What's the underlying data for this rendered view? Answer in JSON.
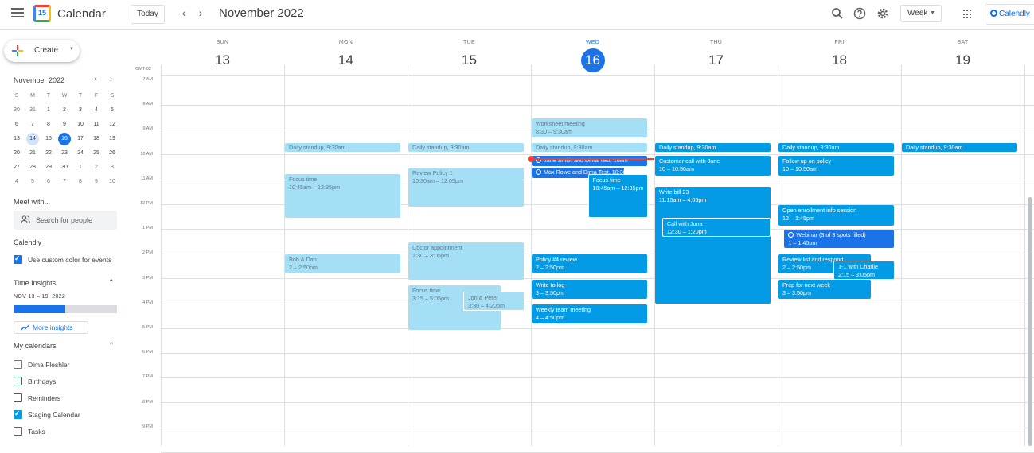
{
  "header": {
    "app_title": "Calendar",
    "logo_text": "15",
    "today_label": "Today",
    "prev_icon": "chevron-left-icon",
    "next_icon": "chevron-right-icon",
    "current_month": "November 2022",
    "view_label": "Week",
    "calendly_label": "Calendly",
    "icons": [
      "search-icon",
      "help-icon",
      "settings-icon",
      "apps-grid-icon"
    ]
  },
  "sidebar": {
    "create_label": "Create",
    "mini_calendar": {
      "title": "November 2022",
      "weekdays": [
        "S",
        "M",
        "T",
        "W",
        "T",
        "F",
        "S"
      ],
      "weeks": [
        [
          "30",
          "31",
          "1",
          "2",
          "3",
          "4",
          "5"
        ],
        [
          "6",
          "7",
          "8",
          "9",
          "10",
          "11",
          "12"
        ],
        [
          "13",
          "14",
          "15",
          "16",
          "17",
          "18",
          "19"
        ],
        [
          "20",
          "21",
          "22",
          "23",
          "24",
          "25",
          "26"
        ],
        [
          "27",
          "28",
          "29",
          "30",
          "1",
          "2",
          "3"
        ],
        [
          "4",
          "5",
          "6",
          "7",
          "8",
          "9",
          "10"
        ]
      ]
    },
    "meet_with": {
      "title": "Meet with...",
      "search_placeholder": "Search for people"
    },
    "calendly": {
      "title": "Calendly",
      "checkbox_label": "Use custom color for events"
    },
    "time_insights": {
      "title": "Time Insights",
      "range": "NOV 13 – 19, 2022",
      "fill_fraction": 0.5,
      "more_label": "More insights"
    },
    "my_calendars": {
      "title": "My calendars",
      "items": [
        {
          "label": "Dima Fleshler",
          "color": "#039be5",
          "checked": false
        },
        {
          "label": "Birthdays",
          "color": "#0b8043",
          "checked": false
        },
        {
          "label": "Reminders",
          "color": "#3f51b5",
          "checked": false
        },
        {
          "label": "Staging Calendar",
          "color": "#039be5",
          "checked": true
        },
        {
          "label": "Tasks",
          "color": "#1a73e8",
          "checked": false
        }
      ]
    }
  },
  "week": {
    "timezone": "GMT-02",
    "days": [
      {
        "dow": "SUN",
        "num": "13"
      },
      {
        "dow": "MON",
        "num": "14"
      },
      {
        "dow": "TUE",
        "num": "15"
      },
      {
        "dow": "WED",
        "num": "16",
        "today": true
      },
      {
        "dow": "THU",
        "num": "17"
      },
      {
        "dow": "FRI",
        "num": "18"
      },
      {
        "dow": "SAT",
        "num": "19"
      }
    ],
    "hours": [
      "7 AM",
      "8 AM",
      "9 AM",
      "10 AM",
      "11 AM",
      "12 PM",
      "1 PM",
      "2 PM",
      "3 PM",
      "4 PM",
      "5 PM",
      "6 PM",
      "7 PM",
      "8 PM",
      "9 PM"
    ],
    "now_hour": 10.15,
    "events": [
      {
        "day": 1,
        "start": 9.5,
        "end": 9.9,
        "title": "Daily standup, 9:30am",
        "style": "light chip"
      },
      {
        "day": 2,
        "start": 9.5,
        "end": 9.9,
        "title": "Daily standup, 9:30am",
        "style": "light chip"
      },
      {
        "day": 3,
        "start": 9.5,
        "end": 9.9,
        "title": "Daily standup, 9:30am",
        "style": "light chip"
      },
      {
        "day": 4,
        "start": 9.5,
        "end": 9.9,
        "title": "Daily standup, 9:30am",
        "style": "dark chip"
      },
      {
        "day": 5,
        "start": 9.5,
        "end": 9.9,
        "title": "Daily standup, 9:30am",
        "style": "dark chip"
      },
      {
        "day": 6,
        "start": 9.5,
        "end": 9.9,
        "title": "Daily standup, 9:30am",
        "style": "dark chip"
      },
      {
        "day": 3,
        "start": 8.5,
        "end": 9.3,
        "title": "Worksheet meeting",
        "time": "8:30 – 9:30am",
        "style": "light"
      },
      {
        "day": 3,
        "start": 10.0,
        "end": 10.45,
        "title": "Jane Smith and Dima Test, 10am",
        "style": "highlight chip",
        "recurring": true
      },
      {
        "day": 3,
        "start": 10.5,
        "end": 10.95,
        "title": "Max Rowe and Dima Test, 10:30am",
        "style": "highlight chip",
        "recurring": true,
        "width": 0.8
      },
      {
        "day": 3,
        "start": 10.75,
        "end": 12.55,
        "title": "Focus time",
        "time": "10:45am – 12:35pm",
        "style": "dark outlined",
        "offset": 0.48
      },
      {
        "day": 1,
        "start": 10.75,
        "end": 12.55,
        "title": "Focus time",
        "time": "10:45am – 12:35pm",
        "style": "light"
      },
      {
        "day": 2,
        "start": 10.5,
        "end": 12.1,
        "title": "Review Policy 1",
        "time": "10:30am – 12:05pm",
        "style": "light"
      },
      {
        "day": 4,
        "start": 10.0,
        "end": 10.85,
        "title": "Customer call with Jane",
        "time": "10 – 10:50am",
        "style": "dark"
      },
      {
        "day": 5,
        "start": 10.0,
        "end": 10.85,
        "title": "Follow up on policy",
        "time": "10 – 10:50am",
        "style": "dark"
      },
      {
        "day": 4,
        "start": 11.25,
        "end": 16.0,
        "title": "Write bill 23",
        "time": "11:15am – 4:05pm",
        "style": "dark"
      },
      {
        "day": 4,
        "start": 12.5,
        "end": 13.3,
        "title": "Call with Jona",
        "time": "12:30 – 1:20pm",
        "style": "dark outlined",
        "offset": 0.06
      },
      {
        "day": 5,
        "start": 12.0,
        "end": 12.85,
        "title": "Open enrollment info session",
        "time": "12 – 1:45pm",
        "style": "dark"
      },
      {
        "day": 5,
        "start": 13.0,
        "end": 13.75,
        "title": "Webinar (3 of 3 spots filled)",
        "time": "1 – 1:45pm",
        "style": "highlight",
        "recurring": true,
        "offset": 0.05
      },
      {
        "day": 1,
        "start": 14.0,
        "end": 14.8,
        "title": "Bob & Dan",
        "time": "2 – 2:50pm",
        "style": "light"
      },
      {
        "day": 2,
        "start": 13.5,
        "end": 15.05,
        "title": "Doctor appointment",
        "time": "1:30 – 3:05pm",
        "style": "light"
      },
      {
        "day": 3,
        "start": 14.0,
        "end": 14.8,
        "title": "Policy #4 review",
        "time": "2 – 2:50pm",
        "style": "dark"
      },
      {
        "day": 5,
        "start": 14.0,
        "end": 14.8,
        "title": "Review list and respond",
        "time": "2 – 2:50pm",
        "style": "dark",
        "width": 0.8
      },
      {
        "day": 5,
        "start": 14.25,
        "end": 15.05,
        "title": "1-1 with Charlie",
        "time": "2:15 – 3:05pm",
        "style": "dark outlined",
        "offset": 0.47
      },
      {
        "day": 2,
        "start": 15.25,
        "end": 17.05,
        "title": "Focus time",
        "time": "3:15 – 5:05pm",
        "style": "light",
        "width": 0.8
      },
      {
        "day": 2,
        "start": 15.5,
        "end": 16.3,
        "title": "Jon & Peter",
        "time": "3:30 – 4:20pm",
        "style": "light outlined",
        "offset": 0.47
      },
      {
        "day": 3,
        "start": 15.0,
        "end": 15.8,
        "title": "Write to log",
        "time": "3 – 3:50pm",
        "style": "dark"
      },
      {
        "day": 5,
        "start": 15.0,
        "end": 15.8,
        "title": "Prep for next week",
        "time": "3 – 3:50pm",
        "style": "dark",
        "width": 0.8
      },
      {
        "day": 3,
        "start": 16.0,
        "end": 16.8,
        "title": "Weekly team meeting",
        "time": "4 – 4:50pm",
        "style": "dark"
      }
    ]
  }
}
